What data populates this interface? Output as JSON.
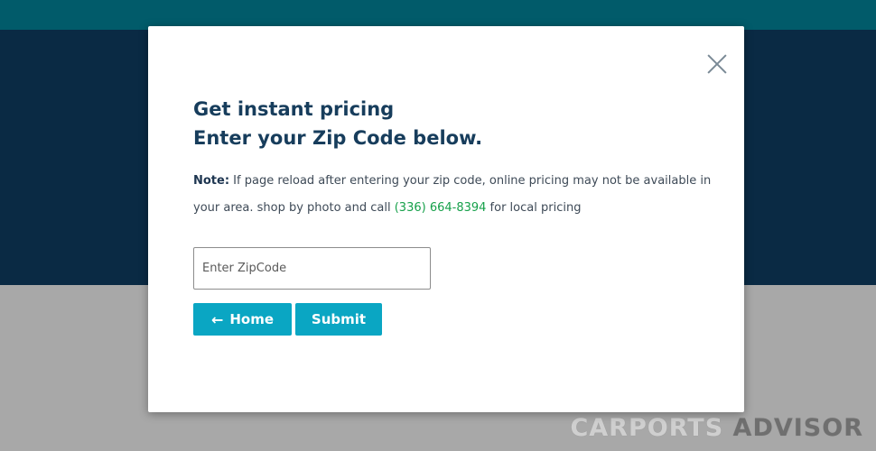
{
  "modal": {
    "title_line1": "Get instant pricing",
    "title_line2": "Enter your Zip Code below.",
    "note_label": "Note:",
    "note_text1": " If page reload after entering your zip code, online pricing may not be available in your area. shop by photo and call ",
    "phone": "(336) 664-8394",
    "note_text2": " for local pricing",
    "zip_placeholder": "Enter ZipCode",
    "home_label": "Home",
    "submit_label": "Submit",
    "close_icon": "close-icon",
    "home_icon": "arrow-left-icon"
  },
  "watermark": {
    "part1": "CARPORTS ",
    "part2": "ADVISOR"
  },
  "colors": {
    "top_band": "#015b6a",
    "hero": "#0a2a44",
    "button": "#0aa6c3",
    "phone": "#16a04a",
    "title": "#173d5c"
  }
}
